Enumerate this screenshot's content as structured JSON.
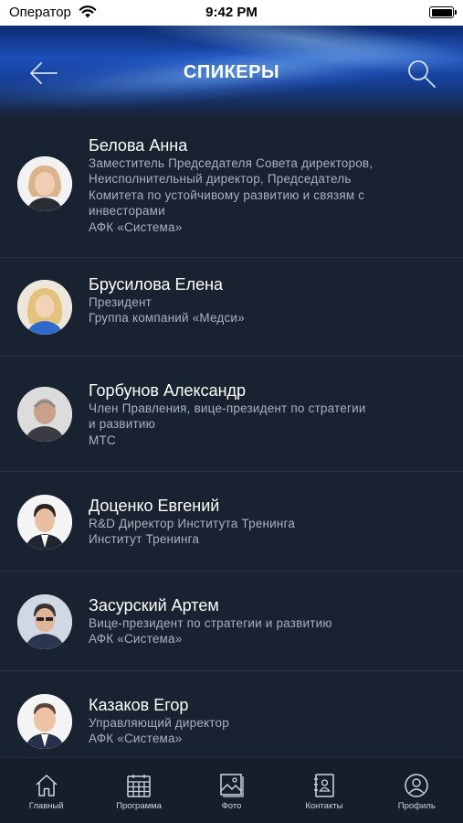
{
  "status_bar": {
    "carrier": "Оператор",
    "time": "9:42 PM"
  },
  "header": {
    "title": "СПИКЕРЫ",
    "back_icon": "arrow-left-icon",
    "search_icon": "search-icon"
  },
  "speakers": [
    {
      "name": "Белова Анна",
      "role_lines": [
        "Заместитель Председателя Совета директоров,",
        "Неисполнительный директор, Председатель",
        "Комитета по устойчивому развитию и связям с",
        "инвесторами"
      ],
      "company": "АФК «Система»"
    },
    {
      "name": "Брусилова Елена",
      "role_lines": [
        "Президент"
      ],
      "company": "Группа компаний «Медси»"
    },
    {
      "name": "Горбунов Александр",
      "role_lines": [
        "Член Правления, вице-президент по стратегии",
        "и развитию"
      ],
      "company": "МТС"
    },
    {
      "name": "Доценко Евгений",
      "role_lines": [
        "R&D Директор Института Тренинга"
      ],
      "company": "Институт Тренинга"
    },
    {
      "name": "Засурский Артем",
      "role_lines": [
        "Вице-президент по стратегии и развитию"
      ],
      "company": "АФК «Система»"
    },
    {
      "name": "Казаков Егор",
      "role_lines": [
        "Управляющий директор"
      ],
      "company": "АФК «Система»"
    }
  ],
  "tabbar": [
    {
      "label": "Главный",
      "icon": "home-icon"
    },
    {
      "label": "Программа",
      "icon": "calendar-icon"
    },
    {
      "label": "Фото",
      "icon": "photo-icon"
    },
    {
      "label": "Контакты",
      "icon": "contacts-book-icon"
    },
    {
      "label": "Профиль",
      "icon": "profile-icon"
    }
  ]
}
